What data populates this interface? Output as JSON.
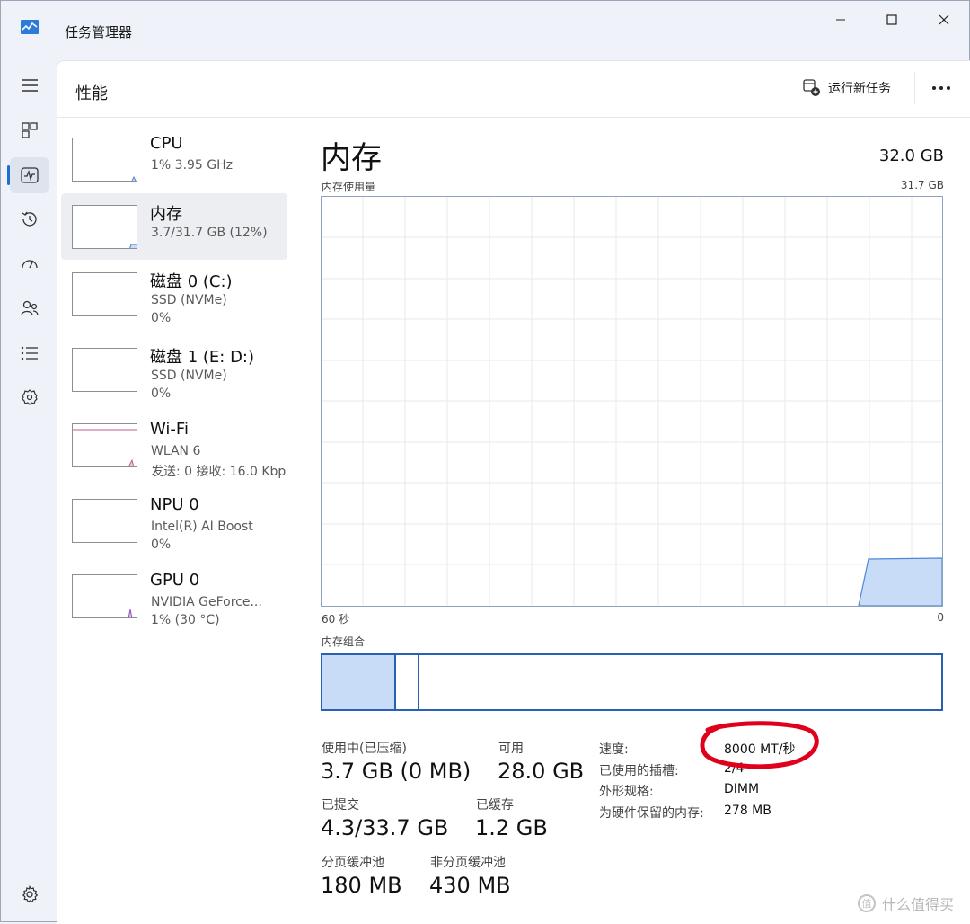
{
  "window": {
    "title": "任务管理器"
  },
  "header": {
    "page_title": "性能",
    "run_task_label": "运行新任务"
  },
  "sidebar": {
    "items": [
      {
        "name": "menu",
        "icon": "hamburger-icon"
      },
      {
        "name": "processes",
        "icon": "processes-icon"
      },
      {
        "name": "performance",
        "icon": "performance-icon",
        "active": true
      },
      {
        "name": "app-history",
        "icon": "history-icon"
      },
      {
        "name": "startup",
        "icon": "startup-icon"
      },
      {
        "name": "users",
        "icon": "users-icon"
      },
      {
        "name": "details",
        "icon": "details-icon"
      },
      {
        "name": "services",
        "icon": "services-icon"
      },
      {
        "name": "settings",
        "icon": "gear-icon"
      }
    ]
  },
  "resources": [
    {
      "name": "CPU",
      "sub1": "1%  3.95 GHz",
      "sub2": ""
    },
    {
      "name": "内存",
      "sub1": "3.7/31.7 GB (12%)",
      "sub2": ""
    },
    {
      "name": "磁盘 0 (C:)",
      "sub1": "SSD (NVMe)",
      "sub2": "0%"
    },
    {
      "name": "磁盘 1 (E: D:)",
      "sub1": "SSD (NVMe)",
      "sub2": "0%"
    },
    {
      "name": "Wi-Fi",
      "sub1": "WLAN 6",
      "sub2": "发送: 0 接收: 16.0 Kbp"
    },
    {
      "name": "NPU 0",
      "sub1": "Intel(R) AI Boost",
      "sub2": "0%"
    },
    {
      "name": "GPU 0",
      "sub1": "NVIDIA GeForce...",
      "sub2": "1% (30 °C)"
    }
  ],
  "detail": {
    "title": "内存",
    "total": "32.0 GB",
    "usage_label": "内存使用量",
    "usage_max": "31.7 GB",
    "axis_left": "60 秒",
    "axis_right": "0",
    "composition_label": "内存组合",
    "stats": {
      "in_use_label": "使用中(已压缩)",
      "in_use_value": "3.7 GB (0 MB)",
      "available_label": "可用",
      "available_value": "28.0 GB",
      "committed_label": "已提交",
      "committed_value": "4.3/33.7 GB",
      "cached_label": "已缓存",
      "cached_value": "1.2 GB",
      "paged_label": "分页缓冲池",
      "paged_value": "180 MB",
      "nonpaged_label": "非分页缓冲池",
      "nonpaged_value": "430 MB"
    },
    "props": [
      {
        "label": "速度:",
        "value": "8000 MT/秒"
      },
      {
        "label": "已使用的插槽:",
        "value": "2/4"
      },
      {
        "label": "外形规格:",
        "value": "DIMM"
      },
      {
        "label": "为硬件保留的内存:",
        "value": "278 MB"
      }
    ]
  },
  "watermark": "什么值得买",
  "colors": {
    "accent": "#1f6fd1",
    "graph_fill": "#c9dcf7",
    "graph_line": "#4f86d8",
    "annotation": "#e0001b"
  }
}
